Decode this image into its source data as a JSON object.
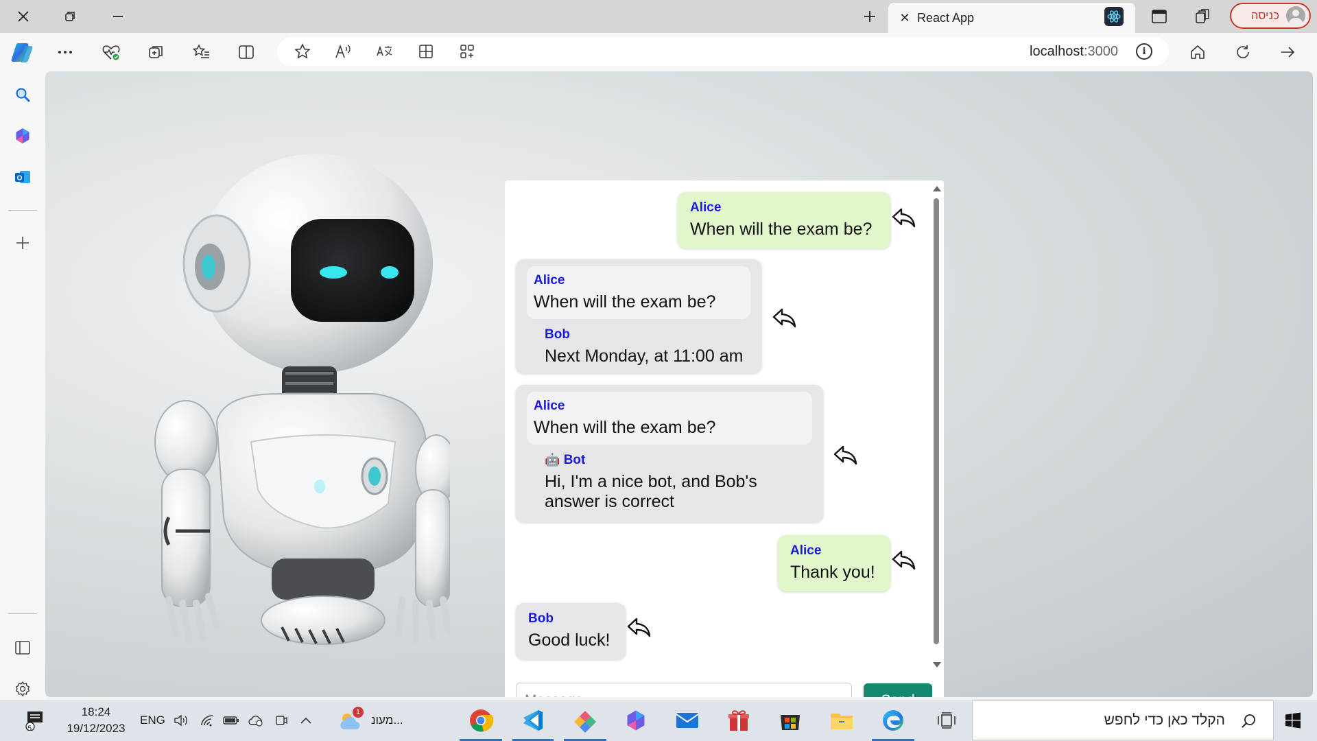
{
  "browser": {
    "tab_title": "React App",
    "profile_label": "כניסה",
    "url_host": "localhost",
    "url_port": ":3000"
  },
  "chat": {
    "messages": [
      {
        "sender": "Alice",
        "text": "When will the exam be?",
        "side": "mine"
      },
      {
        "quote_sender": "Alice",
        "quote_text": "When will the exam be?",
        "sender": "Bob",
        "text": "Next Monday, at 11:00 am",
        "side": "other"
      },
      {
        "quote_sender": "Alice",
        "quote_text": "When will the exam be?",
        "sender": "Bot",
        "sender_emoji": "🤖",
        "text": "Hi, I'm a nice bot, and Bob's answer is correct",
        "side": "other"
      },
      {
        "sender": "Alice",
        "text": "Thank you!",
        "side": "mine"
      },
      {
        "sender": "Bob",
        "text": "Good luck!",
        "side": "other"
      }
    ],
    "input_placeholder": "Message...",
    "send_label": "Send"
  },
  "taskbar": {
    "time": "18:24",
    "date": "19/12/2023",
    "lang": "ENG",
    "notification_count": "5",
    "weather_label": "מעונ...",
    "weather_badge": "1",
    "search_placeholder": "הקלד כאן כדי לחפש"
  },
  "colors": {
    "mine_bubble": "#e1f7cb",
    "other_bubble": "#e6e6ea",
    "sender_name": "#1a1adf",
    "send_button": "#14876f"
  }
}
